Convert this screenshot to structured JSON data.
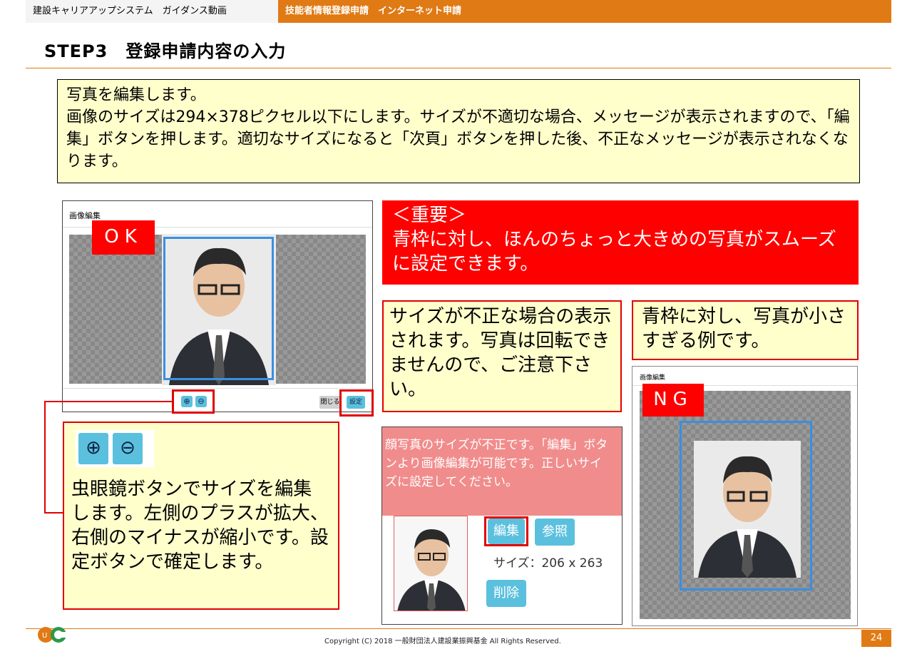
{
  "header": {
    "left_text": "建設キャリアアップシステム　ガイダンス動画",
    "right_text": "技能者情報登録申請　インターネット申請"
  },
  "page_title": "STEP3　登録申請内容の入力",
  "instructions": {
    "line1": "写真を編集します。",
    "line2": "画像のサイズは294×378ピクセル以下にします。サイズが不適切な場合、メッセージが表示されますので、「編集」ボタンを押します。適切なサイズになると「次頁」ボタンを押した後、不正なメッセージが表示されなくなります。"
  },
  "ok_panel": {
    "dialog_title": "画像編集",
    "label": "OK",
    "close_label": "閉じる",
    "set_label": "設定"
  },
  "important": {
    "heading": "＜重要＞",
    "body": "青枠に対し、ほんのちょっと大きめの写真がスムーズに設定できます。"
  },
  "invalid_note": "サイズが不正な場合の表示されます。写真は回転できませんので、ご注意下さい。",
  "small_note": "青枠に対し、写真が小さすぎる例です。",
  "magnifier_note": "虫眼鏡ボタンでサイズを編集します。左側のプラスが拡大、右側のマイナスが縮小です。設定ボタンで確定します。",
  "error_panel": {
    "error_message": "顔写真のサイズが不正です。「編集」ボタンより画像編集が可能です。正しいサイズに設定してください。",
    "edit_label": "編集",
    "browse_label": "参照",
    "size_text": "サイズ：206 x 263",
    "delete_label": "削除"
  },
  "ng_panel": {
    "dialog_title": "画像編集",
    "label": "NG"
  },
  "footer": {
    "copyright": "Copyright (C) 2018 一般財団法人建設業振興基金 All Rights Reserved.",
    "page_number": "24"
  },
  "colors": {
    "accent_orange": "#e07a14",
    "alert_red": "#ff0000",
    "note_yellow": "#ffffcc",
    "frame_blue": "#3a8fe0",
    "button_blue": "#5bc0de"
  }
}
